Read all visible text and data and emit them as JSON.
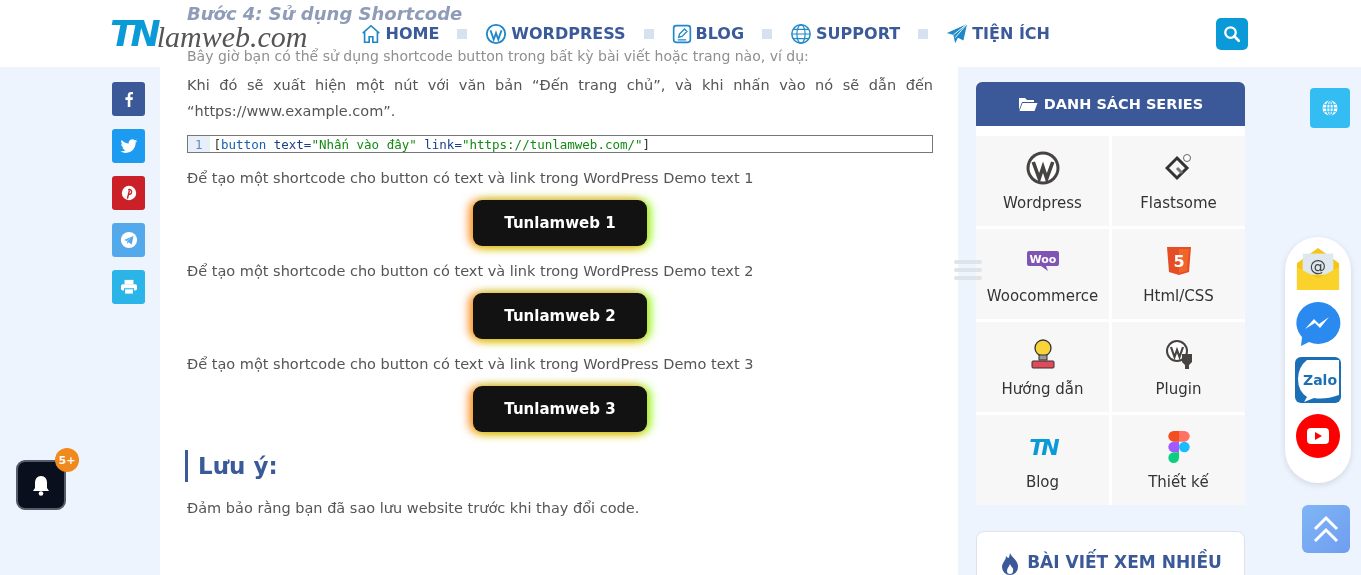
{
  "header": {
    "logo_mark": "TN",
    "logo_text": "lamweb.com",
    "nav": [
      {
        "label": "HOME"
      },
      {
        "label": "WORDPRESS"
      },
      {
        "label": "BLOG"
      },
      {
        "label": "SUPPORT"
      },
      {
        "label": "TIỆN ÍCH"
      }
    ]
  },
  "notification": {
    "badge": "5+"
  },
  "article": {
    "heading": "Bước 4: Sử dụng Shortcode",
    "intro": "Bây giờ bạn có thể sử dụng shortcode button trong bất kỳ bài viết hoặc trang nào, ví dụ:",
    "paragraph": "Khi đó sẽ xuất hiện một nút với văn bản “Đến trang chủ”, và khi nhấn vào nó sẽ dẫn đến “https://www.example.com”.",
    "code": {
      "line_number": "1",
      "open": "[",
      "tag": "button",
      "attr1": "text=",
      "value1": "\"Nhấn vào đây\"",
      "attr2": "link=",
      "value2": "\"https://tunlamweb.com/\"",
      "close": "]"
    },
    "demos": [
      {
        "text": "Để tạo một shortcode cho button có text và link trong WordPress Demo text 1",
        "button": "Tunlamweb 1"
      },
      {
        "text": "Để tạo một shortcode cho button có text và link trong WordPress Demo text 2",
        "button": "Tunlamweb 2"
      },
      {
        "text": "Để tạo một shortcode cho button có text và link trong WordPress Demo text 3",
        "button": "Tunlamweb 3"
      }
    ],
    "note_heading": "Lưu ý:",
    "note": "Đảm bảo rằng bạn đã sao lưu website trước khi thay đổi code."
  },
  "series": {
    "title": "DANH SÁCH SERIES",
    "items": [
      {
        "label": "Wordpress"
      },
      {
        "label": "Flastsome"
      },
      {
        "label": "Woocommerce",
        "icon_text": "Woo"
      },
      {
        "label": "Html/CSS",
        "icon_text": "5"
      },
      {
        "label": "Hướng dẫn"
      },
      {
        "label": "Plugin"
      },
      {
        "label": "Blog",
        "icon_text": "TN"
      },
      {
        "label": "Thiết kế"
      }
    ]
  },
  "popular": {
    "title": "BÀI VIẾT XEM NHIỀU"
  },
  "contacts": [
    {
      "kind": "mail",
      "glyph": "@"
    },
    {
      "kind": "messenger"
    },
    {
      "kind": "zalo",
      "glyph": "Zalo"
    },
    {
      "kind": "youtube"
    }
  ]
}
